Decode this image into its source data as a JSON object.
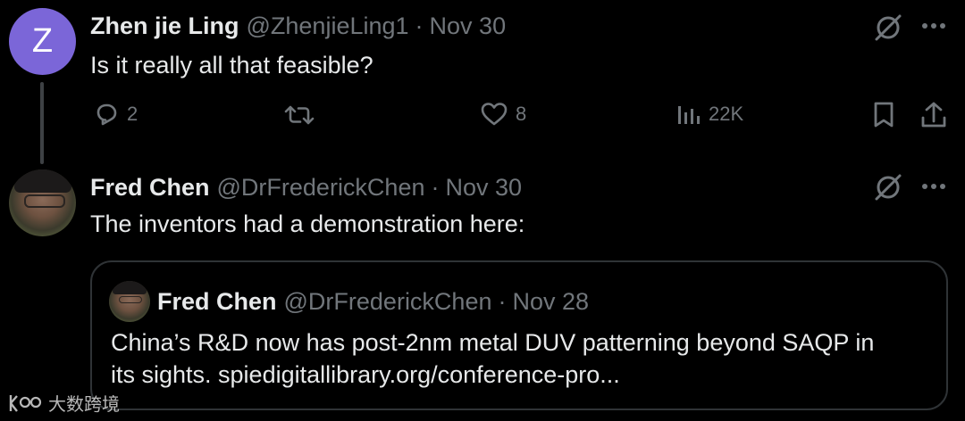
{
  "tweet1": {
    "avatar_letter": "Z",
    "name": "Zhen jie Ling",
    "handle": "@ZhenjieLing1",
    "separator": "·",
    "date": "Nov 30",
    "text": "Is it really all that feasible?",
    "actions": {
      "replies": "2",
      "likes": "8",
      "views": "22K"
    }
  },
  "tweet2": {
    "name": "Fred Chen",
    "handle": "@DrFrederickChen",
    "separator": "·",
    "date": "Nov 30",
    "text": "The inventors had a demonstration here:"
  },
  "quoted": {
    "name": "Fred Chen",
    "handle": "@DrFrederickChen",
    "separator": "·",
    "date": "Nov 28",
    "line1": "China’s R&D now has post-2nm metal DUV patterning beyond SAQP in",
    "line2": "its sights. spiedigitallibrary.org/conference-pro..."
  },
  "watermark": {
    "text": "大数跨境"
  },
  "colors": {
    "background": "#000000",
    "text_primary": "#e7e9ea",
    "text_secondary": "#71767b",
    "avatar_purple": "#7b66d8",
    "border": "#2f3336"
  }
}
